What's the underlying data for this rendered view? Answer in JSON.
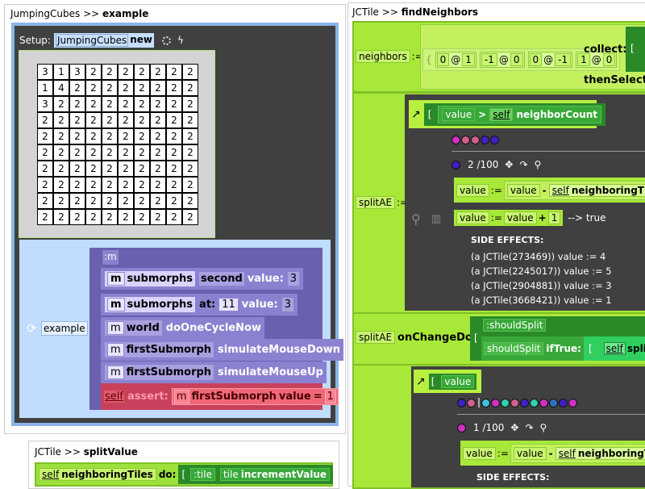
{
  "left_panel": {
    "title_class": "JumpingCubes",
    "title_sep": ">>",
    "title_method": "example",
    "setup_label": "Setup:",
    "setup_class": "JumpingCubes",
    "setup_msg": "new",
    "grid": [
      [
        3,
        1,
        3,
        2,
        2,
        2,
        2,
        2,
        2,
        2
      ],
      [
        1,
        4,
        2,
        2,
        2,
        2,
        2,
        2,
        2,
        2
      ],
      [
        3,
        2,
        2,
        2,
        2,
        2,
        2,
        2,
        2,
        2
      ],
      [
        2,
        2,
        2,
        2,
        2,
        2,
        2,
        2,
        2,
        2
      ],
      [
        2,
        2,
        2,
        2,
        2,
        2,
        2,
        2,
        2,
        2
      ],
      [
        2,
        2,
        2,
        2,
        2,
        2,
        2,
        2,
        2,
        2
      ],
      [
        2,
        2,
        2,
        2,
        2,
        2,
        2,
        2,
        2,
        2
      ],
      [
        2,
        2,
        2,
        2,
        2,
        2,
        2,
        2,
        2,
        2
      ],
      [
        2,
        2,
        2,
        2,
        2,
        2,
        2,
        2,
        2,
        2
      ],
      [
        2,
        2,
        2,
        2,
        2,
        2,
        2,
        2,
        2,
        2
      ]
    ],
    "example_label": "example",
    "bracket": "[",
    "block_arg": ":m",
    "rows": [
      {
        "recv": "m",
        "sel1": "submorphs",
        "sel2": "second",
        "kw": "value:",
        "arg": "3"
      },
      {
        "recv": "m",
        "sel1": "submorphs",
        "sel2": "at:",
        "arg1": "11",
        "kw": "value:",
        "arg": "3"
      },
      {
        "recv": "m",
        "sel1": "world",
        "msg": "doOneCycleNow"
      },
      {
        "recv": "m",
        "sel1": "firstSubmorph",
        "msg": "simulateMouseDown"
      },
      {
        "recv": "m",
        "sel1": "firstSubmorph",
        "msg": "simulateMouseUp"
      }
    ],
    "assert": {
      "self": "self",
      "kw": "assert:",
      "recv": "m",
      "sel1": "firstSubmorph",
      "sel2": "value",
      "op": "=",
      "arg": "1"
    }
  },
  "bottom_panel": {
    "title_class": "JCTile",
    "title_sep": ">>",
    "title_method": "splitValue",
    "self": "self",
    "sel": "neighboringTiles",
    "kw": "do:",
    "bracket": "[",
    "arg": ":tile",
    "recv": "tile",
    "msg": "incrementValue"
  },
  "right_panel": {
    "title_class": "JCTile",
    "title_sep": ">>",
    "title_method": "findNeighbors",
    "neighbors": {
      "var": "neighbors",
      "assign": ":=",
      "brace": "{",
      "points": [
        [
          "0",
          "@",
          "1"
        ],
        [
          "-1",
          "@",
          "0"
        ],
        [
          "0",
          "@",
          "-1"
        ],
        [
          "1",
          "@",
          "0"
        ]
      ],
      "collect": "collect:",
      "bracket": "[",
      "then_select": "thenSelect:"
    },
    "split_ae": {
      "var": "splitAE",
      "assign": ":=",
      "block": {
        "bracket": "[",
        "recv": "value",
        "op": ">",
        "self": "self",
        "msg": "neighborCount"
      },
      "dots": [
        "#d030c0",
        "#d06090",
        "#d06090",
        "#4020c0",
        "#4020c0"
      ],
      "current_dot": "#4020c0",
      "counter": "2 /100",
      "line1": {
        "var": "value",
        "assign": ":=",
        "recv": "value",
        "op": "-",
        "self": "self",
        "msg": "neighboringTile"
      },
      "line2": {
        "var": "value",
        "assign": ":=",
        "recv": "value",
        "op": "+",
        "arg": "1",
        "result": "--> true"
      },
      "side_effects_label": "SIDE EFFECTS:",
      "side_effects": [
        "(a JCTile(273469)) value := 4",
        "(a JCTile(2245017)) value := 5",
        "(a JCTile(2904881)) value := 3",
        "(a JCTile(3668421)) value := 1"
      ]
    },
    "on_change": {
      "recv": "splitAE",
      "kw": "onChangeDo:",
      "bracket": "[",
      "arg": ":shouldSplit",
      "var": "shouldSplit",
      "kw2": "ifTrue:",
      "bracket2": "[",
      "self": "self",
      "msg": "split"
    },
    "value_ae": {
      "bracket": "[",
      "recv": "value",
      "dots": [
        "#4020c0",
        "#d06090",
        "|",
        "#40c0e0",
        "#d030c0",
        "#30d0b0",
        "#d06090",
        "#4020c0",
        "#30d0b0",
        "#d030c0",
        "#3070c0",
        "#4020c0",
        "#d030c0"
      ],
      "current_dot": "#d030c0",
      "counter": "1 /100",
      "line1": {
        "var": "value",
        "assign": ":=",
        "recv": "value",
        "op": "-",
        "self": "self",
        "msg": "neighboringTil"
      },
      "side_effects_label": "SIDE EFFECTS:"
    }
  }
}
